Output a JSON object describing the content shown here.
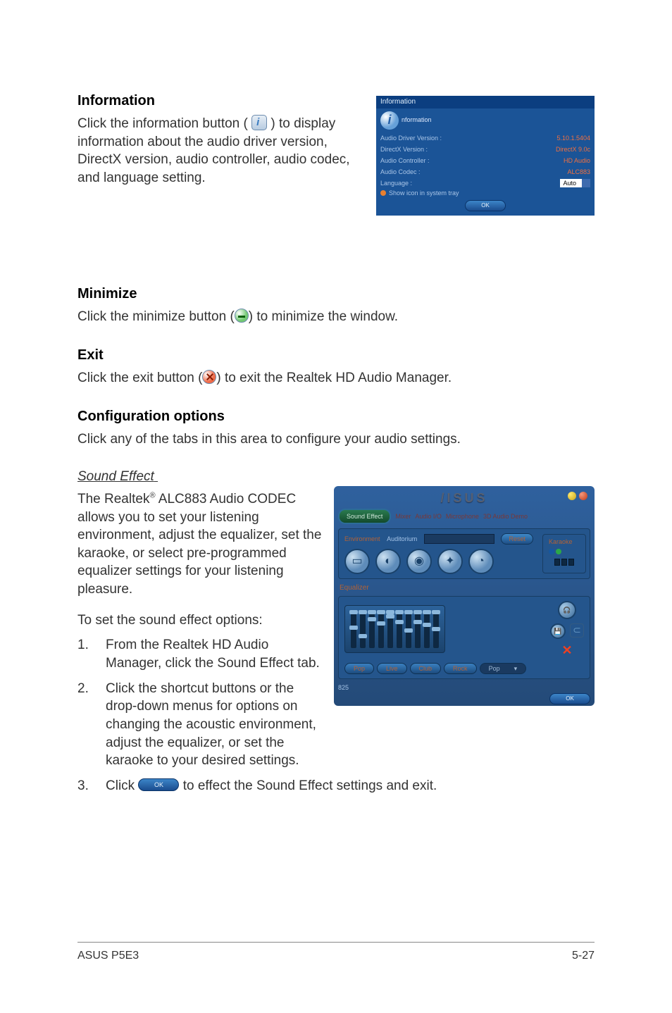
{
  "information": {
    "heading": "Information",
    "body": "Click the information button (        ) to display information about the audio driver version, DirectX version, audio controller, audio codec, and language setting.",
    "panel": {
      "title": "Information",
      "iconLabel": "nformation",
      "rows": [
        {
          "l": "Audio Driver Version :",
          "r": "5.10.1.5404"
        },
        {
          "l": "DirectX Version :",
          "r": "DirectX 9.0c"
        },
        {
          "l": "Audio Controller :",
          "r": "HD Audio"
        },
        {
          "l": "Audio Codec :",
          "r": "ALC883"
        }
      ],
      "langLabel": "Language :",
      "langValue": "Auto",
      "radio": "Show icon in system tray",
      "ok": "OK"
    }
  },
  "minimize": {
    "heading": "Minimize",
    "pre": "Click the minimize button (",
    "post": ") to minimize the window."
  },
  "exit": {
    "heading": "Exit",
    "pre": "Click the exit button (",
    "post": ") to exit the Realtek HD Audio Manager."
  },
  "config": {
    "heading": "Configuration options",
    "body": "Click any of the tabs in this area to configure your audio settings."
  },
  "sound": {
    "subheading": "Sound Effect",
    "para1_pre": "The Realtek",
    "para1_sup": "®",
    "para1_post": " ALC883 Audio CODEC allows you to set your listening environment, adjust the equalizer, set the karaoke, or select pre-programmed equalizer settings for your listening pleasure.",
    "lead": "To set the sound effect options:",
    "steps": [
      "From the Realtek HD Audio Manager, click the Sound Effect tab.",
      "Click the shortcut buttons or the drop-down menus for options on changing the acoustic environment, adjust the equalizer, or set the karaoke to your desired settings."
    ],
    "step3_pre": "Click ",
    "step3_post": " to effect the Sound Effect settings and exit.",
    "panel": {
      "logo": "/ISUS",
      "tabs": [
        "Sound Effect",
        "Mixer",
        "Audio I/O",
        "Microphone",
        "3D Audio Demo"
      ],
      "envLabel": "Environment",
      "audLabel": "Auditorium",
      "reset": "Reset",
      "karaoke": "Karaoke",
      "eq": "Equalizer",
      "presets": [
        "Pop",
        "Live",
        "Club",
        "Rock"
      ],
      "presetDrop": "Pop",
      "num": "825",
      "ok": "OK"
    }
  },
  "footer": {
    "left": "ASUS P5E3",
    "right": "5-27"
  },
  "sliderTops": [
    22,
    34,
    10,
    16,
    6,
    14,
    26,
    14,
    18,
    24
  ]
}
